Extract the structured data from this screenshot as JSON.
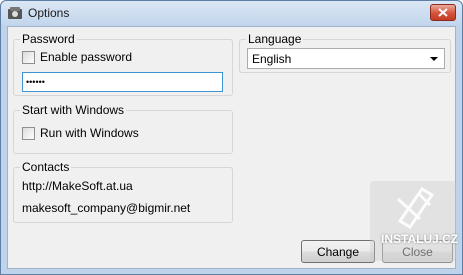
{
  "window": {
    "title": "Options"
  },
  "password_group": {
    "title": "Password",
    "enable_label": "Enable password",
    "password_value": "••••••"
  },
  "language_group": {
    "title": "Language",
    "selected": "English"
  },
  "start_group": {
    "title": "Start with Windows",
    "run_label": "Run with Windows"
  },
  "contacts_group": {
    "title": "Contacts",
    "website": "http://MakeSoft.at.ua",
    "email": "makesoft_company@bigmir.net"
  },
  "buttons": {
    "change": "Change",
    "close": "Close"
  },
  "watermark": {
    "text": "INSTALUJ.CZ"
  }
}
